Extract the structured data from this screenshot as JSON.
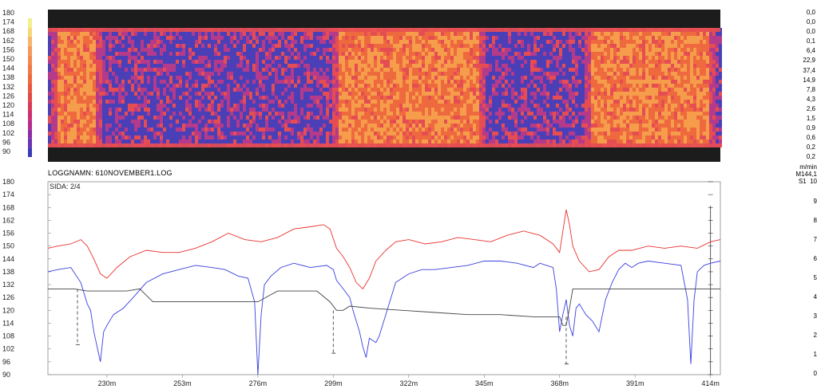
{
  "heatmap": {
    "scale_labels": [
      "180",
      "174",
      "168",
      "162",
      "156",
      "150",
      "144",
      "138",
      "132",
      "126",
      "120",
      "114",
      "108",
      "102",
      "96",
      "90"
    ],
    "scale_colors": [
      "#f2f08a",
      "#f7d77a",
      "#f7b46b",
      "#f59a5c",
      "#f28a50",
      "#ef7a45",
      "#ee6a3e",
      "#e9583e",
      "#e44a45",
      "#db3a58",
      "#cf2d72",
      "#b52c8c",
      "#8e2ca4",
      "#6a34b4",
      "#3b3bb8",
      "#1a2a8a"
    ],
    "band_color": "#1c1c1c",
    "cool_zones": [
      120,
      212,
      228,
      298,
      345,
      375,
      415,
      430,
      448,
      455
    ],
    "colors": {
      "hot": "#f59d4b",
      "mid": "#ee6a3e",
      "warm": "#e64d52",
      "cool": "#b53a8a",
      "cold": "#4b3fb8"
    }
  },
  "log_name": "LOGGNAMN: 610NOVEMBER1.LOG",
  "page": "SIDA: 2/4",
  "chart_data": {
    "type": "line",
    "ylim": [
      90,
      180
    ],
    "yticks": [
      180,
      174,
      168,
      162,
      156,
      150,
      144,
      138,
      132,
      126,
      120,
      114,
      108,
      102,
      96,
      90
    ],
    "xlim": [
      212,
      417
    ],
    "xticks": [
      230,
      253,
      276,
      299,
      322,
      345,
      368,
      391,
      414
    ],
    "xtick_labels": [
      "230m",
      "253m",
      "276m",
      "299m",
      "322m",
      "345m",
      "368m",
      "391m",
      "414m"
    ],
    "series": [
      {
        "color": "#e8312e",
        "x": [
          212,
          215,
          219,
          222,
          224,
          226,
          228,
          230,
          233,
          237,
          242,
          247,
          252,
          257,
          262,
          267,
          272,
          277,
          282,
          287,
          292,
          296,
          298,
          300,
          302,
          304,
          306,
          308,
          310,
          312,
          315,
          318,
          322,
          327,
          332,
          337,
          342,
          347,
          352,
          357,
          362,
          366,
          368,
          369,
          370,
          371,
          372,
          374,
          377,
          380,
          383,
          386,
          390,
          395,
          400,
          405,
          410,
          414,
          417
        ],
        "y": [
          149,
          150,
          151,
          153,
          150,
          144,
          137,
          135,
          140,
          145,
          148,
          147,
          147,
          149,
          152,
          156,
          153,
          152,
          154,
          158,
          159,
          160,
          158,
          149,
          145,
          140,
          133,
          130,
          135,
          143,
          148,
          152,
          153,
          151,
          152,
          154,
          153,
          152,
          155,
          157,
          155,
          151,
          147,
          157,
          167,
          160,
          150,
          143,
          138,
          139,
          145,
          148,
          148,
          150,
          149,
          150,
          149,
          152,
          153
        ]
      },
      {
        "color": "#3a3ee0",
        "x": [
          212,
          215,
          219,
          222,
          224,
          225,
          226,
          227,
          228,
          229,
          230,
          232,
          235,
          238,
          242,
          247,
          252,
          257,
          262,
          266,
          270,
          273,
          275,
          276,
          277,
          278,
          280,
          283,
          287,
          292,
          297,
          299,
          300,
          302,
          304,
          305,
          306,
          307,
          308,
          309,
          310,
          312,
          313,
          315,
          318,
          322,
          326,
          330,
          335,
          340,
          345,
          350,
          355,
          360,
          362,
          364,
          366,
          367,
          368,
          369,
          370,
          371,
          372,
          373,
          374,
          376,
          378,
          380,
          382,
          384,
          386,
          388,
          390,
          392,
          395,
          400,
          405,
          407,
          408,
          409,
          410,
          412,
          414,
          417
        ],
        "y": [
          138,
          139,
          140,
          133,
          123,
          120,
          110,
          103,
          96,
          110,
          113,
          118,
          121,
          126,
          133,
          137,
          139,
          141,
          140,
          139,
          136,
          135,
          124,
          90,
          118,
          132,
          136,
          140,
          142,
          140,
          141,
          139,
          134,
          130,
          126,
          120,
          115,
          110,
          103,
          98,
          107,
          105,
          108,
          118,
          133,
          137,
          139,
          139,
          140,
          141,
          143,
          143,
          142,
          140,
          142,
          141,
          140,
          130,
          110,
          118,
          125,
          113,
          108,
          121,
          123,
          118,
          115,
          110,
          125,
          133,
          139,
          142,
          140,
          142,
          143,
          142,
          141,
          125,
          95,
          125,
          138,
          141,
          142,
          143
        ]
      },
      {
        "color": "#444444",
        "x": [
          212,
          215,
          220,
          224,
          227,
          232,
          236,
          240,
          244,
          248,
          252,
          258,
          264,
          270,
          276,
          282,
          288,
          294,
          298,
          300,
          302,
          304,
          310,
          320,
          330,
          340,
          350,
          360,
          366,
          368,
          369,
          370,
          371,
          372,
          374,
          378,
          384,
          390,
          400,
          410,
          417
        ],
        "y": [
          130,
          130,
          130,
          129,
          129,
          129,
          129,
          130,
          124,
          124,
          124,
          124,
          124,
          124,
          124,
          129,
          129,
          129,
          124,
          120,
          120,
          122,
          121,
          120,
          119,
          118,
          118,
          117,
          117,
          117,
          113,
          113,
          121,
          130,
          130,
          130,
          130,
          130,
          130,
          130,
          130
        ]
      }
    ],
    "dashes": [
      {
        "x": 221,
        "from": 130,
        "to": 104
      },
      {
        "x": 299,
        "from": 120,
        "to": 100
      },
      {
        "x": 370,
        "from": 117,
        "to": 95
      }
    ],
    "cursor_x": 414
  },
  "side_panel": {
    "values": [
      "0,0",
      "0,0",
      "0,0",
      "0,1",
      "6,4",
      "22,9",
      "37,4",
      "14,9",
      "7,8",
      "4,3",
      "2,6",
      "1,5",
      "0,9",
      "0,6",
      "0,2",
      "0,2"
    ],
    "unit": "m/min",
    "meta": "M144,1",
    "s1_label": "S1",
    "s1_value": "10",
    "ticks": [
      "9",
      "8",
      "7",
      "6",
      "5",
      "4",
      "3",
      "2",
      "1",
      "0"
    ]
  }
}
